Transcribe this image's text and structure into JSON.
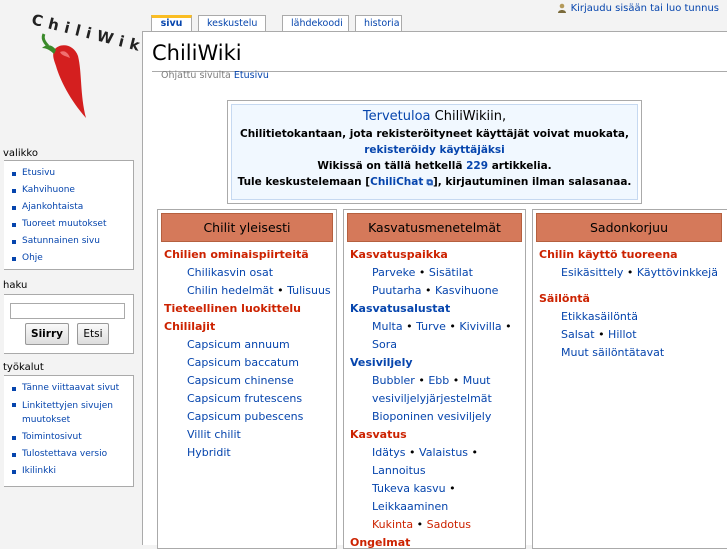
{
  "user_bar": {
    "login_label": "Kirjaudu sisään tai luo tunnus"
  },
  "logo": {
    "text": "ChiliWiki"
  },
  "tabs": [
    {
      "label": "sivu",
      "active": true
    },
    {
      "label": "keskustelu",
      "active": false
    },
    {
      "label": "lähdekoodi",
      "active": false
    },
    {
      "label": "historia",
      "active": false
    }
  ],
  "page": {
    "title": "ChiliWiki",
    "redirect_prefix": "Ohjattu sivulta",
    "redirect_link": "Etusivu"
  },
  "welcome": {
    "line1_link": "Tervetuloa",
    "line1_rest": "ChiliWikiin,",
    "line2": "Chilitietokantaan, jota rekisteröityneet käyttäjät voivat muokata,",
    "line3_link": "rekisteröidy käyttäjäksi",
    "line4_pre": "Wikissä on tällä hetkellä",
    "line4_count": "229",
    "line4_post": "artikkelia.",
    "line5_pre": "Tule keskustelemaan [",
    "line5_link": "ChiliChat",
    "line5_post": "], kirjautuminen ilman salasanaa."
  },
  "columns": [
    {
      "header": "Chilit yleisesti",
      "items": [
        {
          "text": "Chilien ominaispiirteitä",
          "kind": "sec"
        },
        {
          "text": "Chilikasvin osat",
          "kind": "sub"
        },
        {
          "text": "Chilin hedelmät • Tulisuus",
          "kind": "sub"
        },
        {
          "text": "Tieteellinen luokittelu",
          "kind": "sec"
        },
        {
          "text": "Chililajit",
          "kind": "sec"
        },
        {
          "text": "Capsicum annuum",
          "kind": "sub"
        },
        {
          "text": "Capsicum baccatum",
          "kind": "sub"
        },
        {
          "text": "Capsicum chinense",
          "kind": "sub"
        },
        {
          "text": "Capsicum frutescens",
          "kind": "sub"
        },
        {
          "text": "Capsicum pubescens",
          "kind": "sub"
        },
        {
          "text": "Villit chilit",
          "kind": "sub"
        },
        {
          "text": "Hybridit",
          "kind": "sub"
        }
      ]
    },
    {
      "header": "Kasvatusmenetelmät",
      "items": [
        {
          "text": "Kasvatuspaikka",
          "kind": "sec"
        },
        {
          "text": "Parveke • Sisätilat",
          "kind": "sub2"
        },
        {
          "text": "Puutarha • Kasvihuone",
          "kind": "sub2"
        },
        {
          "text": "Kasvatusalustat",
          "kind": "secblue"
        },
        {
          "text": "Multa • Turve • Kivivilla •",
          "kind": "sub2"
        },
        {
          "text": "Sora",
          "kind": "sub2"
        },
        {
          "text": "Vesiviljely",
          "kind": "secblue"
        },
        {
          "text": "Bubbler • Ebb • Muut",
          "kind": "sub2"
        },
        {
          "text": "vesiviljelyjärjestelmät",
          "kind": "sub2"
        },
        {
          "text": "Bioponinen vesiviljely",
          "kind": "sub2"
        },
        {
          "text": "Kasvatus",
          "kind": "sec"
        },
        {
          "text": "Idätys • Valaistus •",
          "kind": "sub2"
        },
        {
          "text": "Lannoitus",
          "kind": "sub2"
        },
        {
          "text": "Tukeva kasvu •",
          "kind": "sub2"
        },
        {
          "text": "Leikkaaminen",
          "kind": "sub2"
        },
        {
          "text": "Kukinta • Sadotus",
          "kind": "sub2red"
        },
        {
          "text": "Ongelmat",
          "kind": "sec"
        }
      ]
    },
    {
      "header": "Sadonkorjuu",
      "items": [
        {
          "text": "Chilin käyttö tuoreena",
          "kind": "sec"
        },
        {
          "text": "Esikäsittely • Käyttövinkkejä",
          "kind": "sub2"
        },
        {
          "text": "",
          "kind": "gap"
        },
        {
          "text": "Säilöntä",
          "kind": "sec"
        },
        {
          "text": "Etikkasäilöntä",
          "kind": "sub2"
        },
        {
          "text": "Salsat • Hillot",
          "kind": "sub2"
        },
        {
          "text": "Muut säilöntätavat",
          "kind": "sub2"
        }
      ]
    }
  ],
  "sidebar": {
    "nav_title": "valikko",
    "nav_items": [
      "Etusivu",
      "Kahvihuone",
      "Ajankohtaista",
      "Tuoreet muutokset",
      "Satunnainen sivu",
      "Ohje"
    ],
    "search_title": "haku",
    "search_go": "Siirry",
    "search_search": "Etsi",
    "tools_title": "työkalut",
    "tools_items": [
      "Tänne viittaavat sivut",
      "Linkitettyjen sivujen muutokset",
      "Toimintosivut",
      "Tulostettava versio",
      "Ikilinkki"
    ]
  },
  "colors": {
    "accent_tab": "#fabd23",
    "header_bg": "#d5795a",
    "link": "#0645ad",
    "red_link": "#cc2200"
  }
}
